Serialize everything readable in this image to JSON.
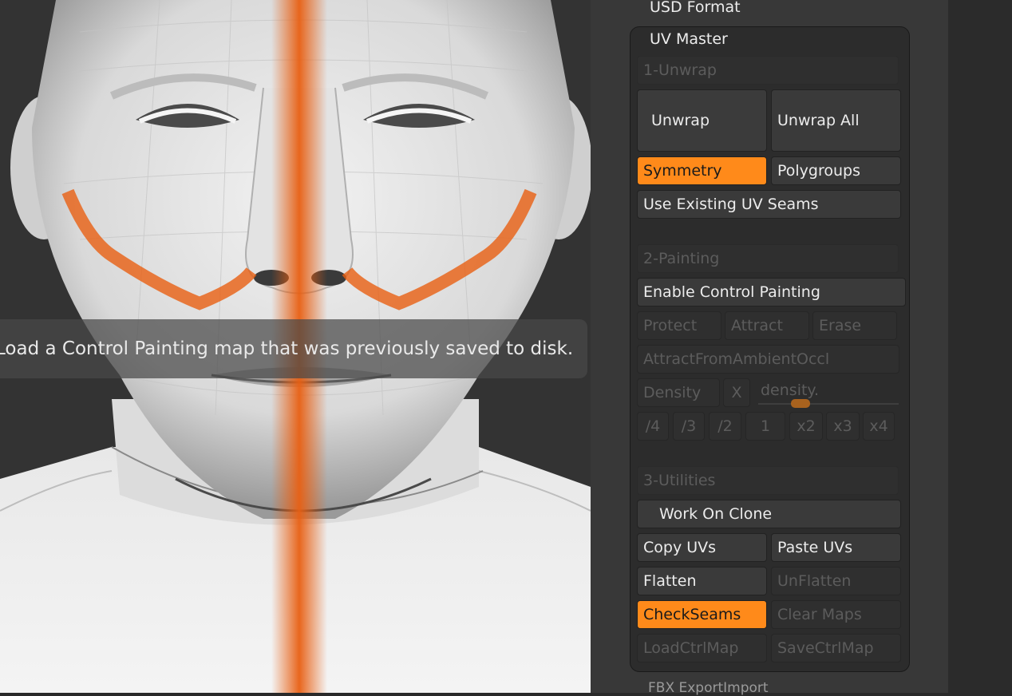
{
  "viewport": {
    "tooltip": "Load a Control Painting map that was previously saved to disk."
  },
  "palette": {
    "usd_format": "USD Format",
    "next_section": "FBX ExportImport"
  },
  "uv_master": {
    "title": "UV Master",
    "unwrap_section": {
      "label": "1-Unwrap",
      "unwrap": "Unwrap",
      "unwrap_all": "Unwrap All",
      "symmetry": "Symmetry",
      "polygroups": "Polygroups",
      "use_existing_seams": "Use Existing UV Seams"
    },
    "painting_section": {
      "label": "2-Painting",
      "enable_control_painting": "Enable Control Painting",
      "protect": "Protect",
      "attract": "Attract",
      "erase": "Erase",
      "attract_from_ao": "AttractFromAmbientOccl",
      "density": "Density",
      "x": "X",
      "density_slider_label": "density.",
      "density_level": 0.3,
      "density_steps": [
        "/4",
        "/3",
        "/2",
        "1",
        "x2",
        "x3",
        "x4"
      ]
    },
    "utilities_section": {
      "label": "3-Utilities",
      "work_on_clone": "Work On Clone",
      "copy_uvs": "Copy UVs",
      "paste_uvs": "Paste UVs",
      "flatten": "Flatten",
      "unflatten": "UnFlatten",
      "check_seams": "CheckSeams",
      "clear_maps": "Clear Maps",
      "load_ctrl_map": "LoadCtrlMap",
      "save_ctrl_map": "SaveCtrlMap"
    }
  },
  "colors": {
    "accent": "#ff8a1a",
    "seam": "#e85f12",
    "panel_bg": "#2c2c2c"
  }
}
